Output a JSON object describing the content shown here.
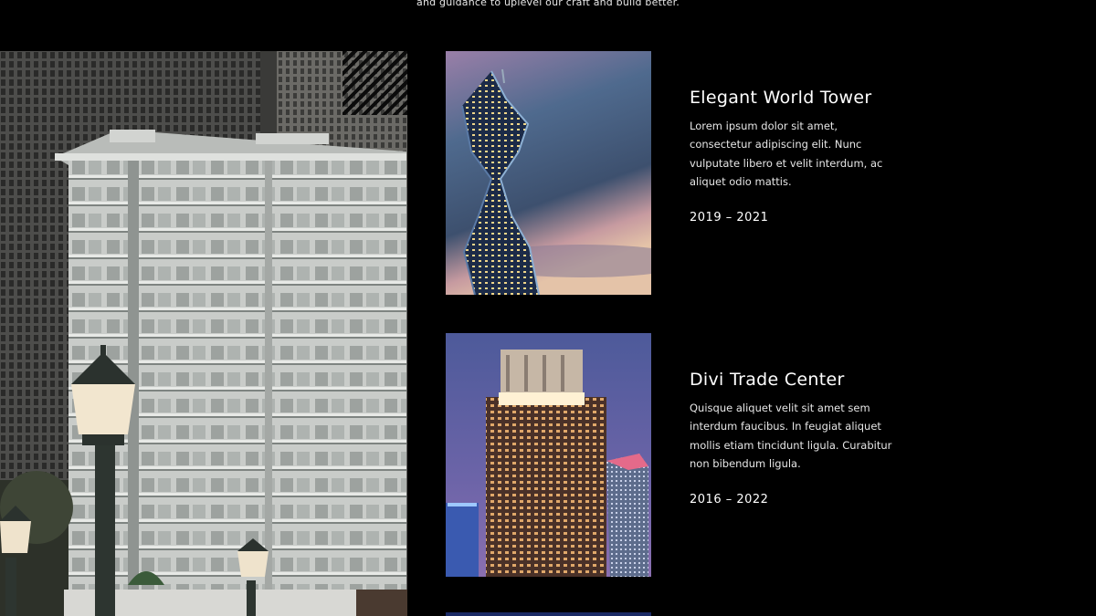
{
  "intro": {
    "text": "and guidance to uplevel our craft and build better."
  },
  "projects": [
    {
      "title": "Elegant World Tower",
      "description": "Lorem ipsum dolor sit amet, consectetur adipiscing elit. Nunc vulputate libero et velit interdum, ac aliquet odio mattis.",
      "years": "2019 – 2021",
      "image": "twisted-skyscraper-photo"
    },
    {
      "title": "Divi Trade Center",
      "description": "Quisque aliquet velit sit amet sem interdum faucibus. In feugiat aliquet mollis etiam tincidunt ligula. Curabitur non bibendum ligula.",
      "years": "2016 – 2022",
      "image": "lit-tower-dusk-photo"
    }
  ],
  "hero": {
    "image": "apartment-building-street-lamps-photo"
  },
  "colors": {
    "background": "#000000",
    "text": "#ffffff",
    "muted_text": "#e6e6e6"
  }
}
